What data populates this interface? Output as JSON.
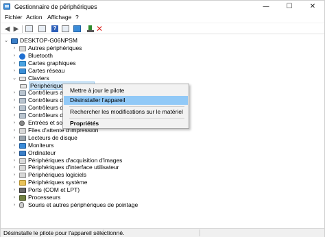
{
  "window": {
    "title": "Gestionnaire de périphériques",
    "controls": {
      "minimize": "—",
      "maximize": "☐",
      "close": "✕"
    }
  },
  "menu": [
    "Fichier",
    "Action",
    "Affichage",
    "?"
  ],
  "toolbar": {
    "icons": [
      "back-arrow-icon",
      "forward-arrow-icon",
      "properties-icon",
      "refresh-icon",
      "help-icon",
      "view-icon",
      "monitor-icon",
      "update-driver-icon",
      "uninstall-icon"
    ],
    "colors": {
      "help": "#2d5fb8",
      "uninstall": "#d9241f",
      "update": "#2e8b2e"
    }
  },
  "tree": {
    "root": "DESKTOP-G06NPSM",
    "nodes": [
      {
        "label": "Autres périphériques",
        "icon": "generic-device-icon",
        "expanded": false
      },
      {
        "label": "Bluetooth",
        "icon": "bluetooth-icon",
        "expanded": false
      },
      {
        "label": "Cartes graphiques",
        "icon": "display-adapter-icon",
        "expanded": false
      },
      {
        "label": "Cartes réseau",
        "icon": "network-adapter-icon",
        "expanded": false
      },
      {
        "label": "Claviers",
        "icon": "keyboard-icon",
        "expanded": true
      },
      {
        "label": "Périphérique clavier PIH",
        "icon": "keyboard-icon",
        "child": true,
        "selected": true
      },
      {
        "label": "Contrôleurs a",
        "icon": "controller-icon",
        "expanded": false
      },
      {
        "label": "Contrôleurs d",
        "icon": "controller-icon",
        "expanded": false
      },
      {
        "label": "Contrôleurs d",
        "icon": "controller-icon",
        "expanded": false
      },
      {
        "label": "Contrôleurs d",
        "icon": "controller-icon",
        "expanded": false
      },
      {
        "label": "Entrées et sor",
        "icon": "audio-icon",
        "expanded": false
      },
      {
        "label": "Files d'attente d'impression",
        "icon": "printer-icon",
        "expanded": false
      },
      {
        "label": "Lecteurs de disque",
        "icon": "disk-icon",
        "expanded": false
      },
      {
        "label": "Moniteurs",
        "icon": "monitor-icon",
        "expanded": false
      },
      {
        "label": "Ordinateur",
        "icon": "computer-icon",
        "expanded": false
      },
      {
        "label": "Périphériques d'acquisition d'images",
        "icon": "camera-icon",
        "expanded": false
      },
      {
        "label": "Périphériques d'interface utilisateur",
        "icon": "hid-icon",
        "expanded": false
      },
      {
        "label": "Périphériques logiciels",
        "icon": "software-device-icon",
        "expanded": false
      },
      {
        "label": "Périphériques système",
        "icon": "system-device-icon",
        "expanded": false
      },
      {
        "label": "Ports (COM et LPT)",
        "icon": "port-icon",
        "expanded": false
      },
      {
        "label": "Processeurs",
        "icon": "processor-icon",
        "expanded": false
      },
      {
        "label": "Souris et autres périphériques de pointage",
        "icon": "mouse-icon",
        "expanded": false
      }
    ]
  },
  "context_menu": {
    "items": [
      {
        "label": "Mettre à jour le pilote"
      },
      {
        "label": "Désinstaller l'appareil",
        "highlighted": true
      },
      {
        "label": "Rechercher les modifications sur le matériel"
      },
      {
        "label": "Propriétés",
        "bold": true
      }
    ],
    "highlight_color": "#91c9f7"
  },
  "status": {
    "text": "Désinstalle le pilote pour l'appareil sélectionné."
  }
}
